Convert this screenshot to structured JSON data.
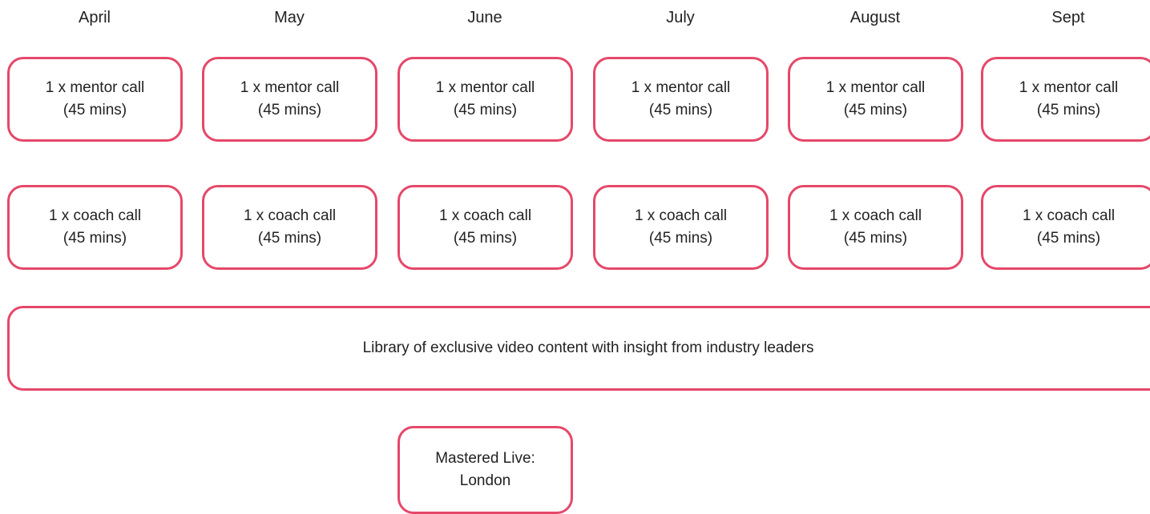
{
  "months": [
    "April",
    "May",
    "June",
    "July",
    "August",
    "Sept"
  ],
  "mentor_calls": [
    {
      "line1": "1 x mentor call",
      "line2": "(45 mins)"
    },
    {
      "line1": "1 x mentor call",
      "line2": "(45 mins)"
    },
    {
      "line1": "1 x mentor call",
      "line2": "(45 mins)"
    },
    {
      "line1": "1 x mentor call",
      "line2": "(45 mins)"
    },
    {
      "line1": "1 x mentor call",
      "line2": "(45 mins)"
    },
    {
      "line1": "1 x mentor call",
      "line2": "(45 mins)"
    }
  ],
  "coach_calls": [
    {
      "line1": "1 x coach call",
      "line2": "(45 mins)"
    },
    {
      "line1": "1 x coach call",
      "line2": "(45 mins)"
    },
    {
      "line1": "1 x coach call",
      "line2": "(45 mins)"
    },
    {
      "line1": "1 x coach call",
      "line2": "(45 mins)"
    },
    {
      "line1": "1 x coach call",
      "line2": "(45 mins)"
    },
    {
      "line1": "1 x coach call",
      "line2": "(45 mins)"
    }
  ],
  "library": {
    "label": "Library of exclusive video content with insight from industry leaders"
  },
  "live_event": {
    "line1": "Mastered Live:",
    "line2": "London"
  },
  "colors": {
    "box_border": "#e5486a",
    "text": "#222222",
    "background": "#ffffff"
  }
}
